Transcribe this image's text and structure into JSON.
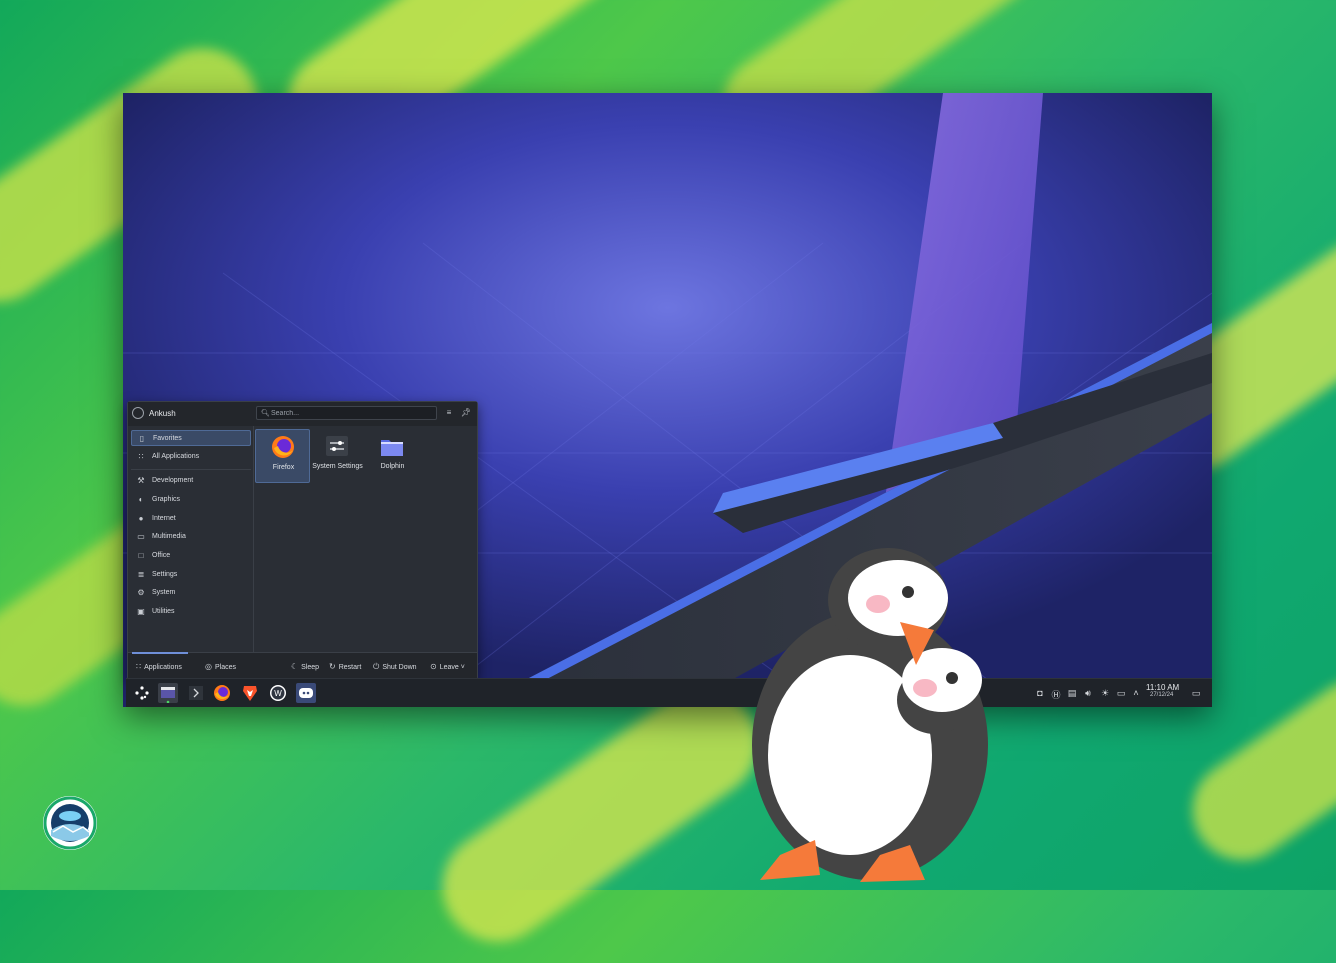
{
  "launcher": {
    "user_name": "Ankush",
    "search_placeholder": "Search...",
    "categories": [
      {
        "label": "Favorites",
        "icon": "bookmark-icon",
        "selected": true
      },
      {
        "label": "All Applications",
        "icon": "grid-icon",
        "selected": false
      },
      {
        "label": "Development",
        "icon": "wrench-icon",
        "selected": false
      },
      {
        "label": "Graphics",
        "icon": "palette-icon",
        "selected": false
      },
      {
        "label": "Internet",
        "icon": "globe-icon",
        "selected": false
      },
      {
        "label": "Multimedia",
        "icon": "monitor-icon",
        "selected": false
      },
      {
        "label": "Office",
        "icon": "document-icon",
        "selected": false
      },
      {
        "label": "Settings",
        "icon": "sliders-icon",
        "selected": false
      },
      {
        "label": "System",
        "icon": "gear-icon",
        "selected": false
      },
      {
        "label": "Utilities",
        "icon": "toolbox-icon",
        "selected": false
      }
    ],
    "favorites": [
      {
        "label": "Firefox",
        "icon": "firefox-icon",
        "selected": true
      },
      {
        "label": "System Settings",
        "icon": "system-settings-icon",
        "selected": false
      },
      {
        "label": "Dolphin",
        "icon": "folder-icon",
        "selected": false
      }
    ],
    "footer": {
      "applications": "Applications",
      "places": "Places",
      "sleep": "Sleep",
      "restart": "Restart",
      "shut_down": "Shut Down",
      "leave": "Leave"
    }
  },
  "taskbar": {
    "apps": [
      "kde-launcher-icon",
      "window-icon",
      "chevron-right-icon",
      "firefox-icon",
      "brave-icon",
      "wps-icon",
      "discord-icon"
    ],
    "tray": [
      "discord-tray-icon",
      "h-circle-icon",
      "clipboard-icon",
      "volume-icon",
      "brightness-icon",
      "network-icon",
      "chevron-up-icon"
    ],
    "clock_time": "11:10 AM",
    "clock_date": "27/12/24"
  },
  "colors": {
    "accent": "#6f8fd8",
    "panel": "#2a2e35",
    "wallpaper_blue": "#2a2f86",
    "background_green": "#2bb86a"
  }
}
